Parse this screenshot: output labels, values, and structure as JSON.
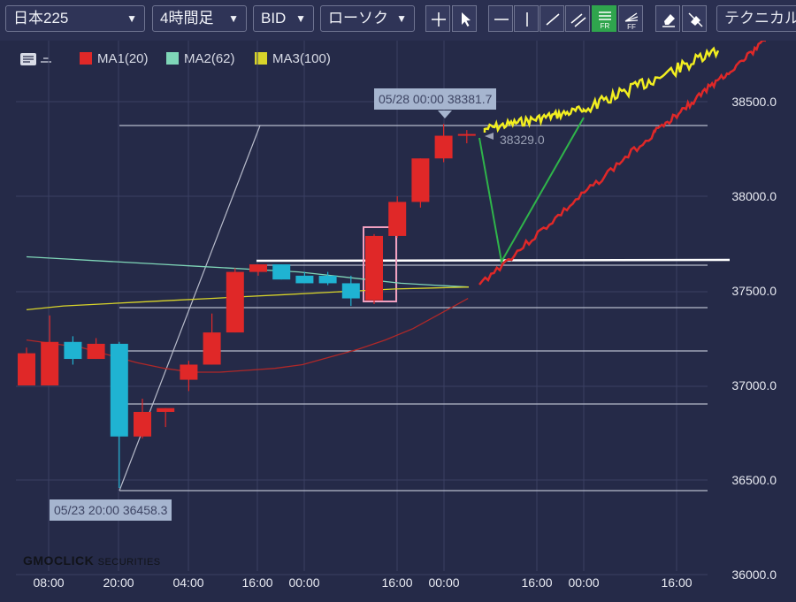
{
  "toolbar": {
    "symbol": "日本225",
    "timeframe": "4時間足",
    "price_type": "BID",
    "chart_type": "ローソク",
    "technical": "テクニカル",
    "tools": [
      "crosshair-icon",
      "pointer-icon",
      "hline-icon",
      "vline-icon",
      "trendline-icon",
      "channel-icon",
      "fibonacci-retracement-icon",
      "fibonacci-fan-icon",
      "eraser-icon",
      "clear-all-icon"
    ],
    "tool_labels": {
      "fr": "FR",
      "ff": "FF"
    }
  },
  "legend": {
    "items": [
      {
        "label": "MA1(20)",
        "color": "#e02828"
      },
      {
        "label": "MA2(62)",
        "color": "#7fd6b8"
      },
      {
        "label": "MA3(100)",
        "color": "#d8d42a"
      }
    ]
  },
  "tooltips": {
    "high": "05/28 00:00 38381.7",
    "low": "05/23 20:00 36458.3",
    "last_value": "38329.0"
  },
  "axes": {
    "y_ticks": [
      "38500.0",
      "38000.0",
      "37500.0",
      "37000.0",
      "36500.0",
      "36000.0"
    ],
    "x_ticks": [
      "08:00",
      "20:00",
      "04:00",
      "16:00",
      "00:00",
      "16:00",
      "00:00",
      "16:00",
      "00:00",
      "16:00"
    ]
  },
  "logo": {
    "brand": "GMOCLICK",
    "suffix": "SECURITIES"
  },
  "colors": {
    "up": "#e02828",
    "down": "#1fb3d2",
    "background": "#252a48",
    "grid": "#3a4062"
  },
  "chart_data": {
    "type": "candlestick",
    "ylim": [
      36000,
      38750
    ],
    "candles": [
      {
        "o": 37000,
        "h": 37200,
        "l": 37000,
        "c": 37170
      },
      {
        "o": 37000,
        "h": 37370,
        "l": 37000,
        "c": 37230
      },
      {
        "o": 37230,
        "h": 37260,
        "l": 37110,
        "c": 37140
      },
      {
        "o": 37140,
        "h": 37250,
        "l": 37140,
        "c": 37220
      },
      {
        "o": 37220,
        "h": 37230,
        "l": 36458,
        "c": 36730
      },
      {
        "o": 36730,
        "h": 36930,
        "l": 36720,
        "c": 36860
      },
      {
        "o": 36860,
        "h": 36880,
        "l": 36780,
        "c": 36880
      },
      {
        "o": 37030,
        "h": 37130,
        "l": 36970,
        "c": 37110
      },
      {
        "o": 37110,
        "h": 37380,
        "l": 37110,
        "c": 37280
      },
      {
        "o": 37280,
        "h": 37620,
        "l": 37280,
        "c": 37600
      },
      {
        "o": 37600,
        "h": 37640,
        "l": 37580,
        "c": 37640
      },
      {
        "o": 37640,
        "h": 37640,
        "l": 37560,
        "c": 37560
      },
      {
        "o": 37580,
        "h": 37600,
        "l": 37540,
        "c": 37540
      },
      {
        "o": 37580,
        "h": 37600,
        "l": 37530,
        "c": 37540
      },
      {
        "o": 37540,
        "h": 37580,
        "l": 37420,
        "c": 37460
      },
      {
        "o": 37450,
        "h": 37800,
        "l": 37430,
        "c": 37790
      },
      {
        "o": 37790,
        "h": 38000,
        "l": 37780,
        "c": 37970
      },
      {
        "o": 37970,
        "h": 38200,
        "l": 37940,
        "c": 38200
      },
      {
        "o": 38200,
        "h": 38381.7,
        "l": 38180,
        "c": 38320
      },
      {
        "o": 38329,
        "h": 38350,
        "l": 38280,
        "c": 38329
      }
    ],
    "series": [
      {
        "name": "MA1(20)",
        "values": [
          37240,
          37220,
          37200,
          37160,
          37120,
          37090,
          37070,
          37070,
          37080,
          37090,
          37110,
          37150,
          37190,
          37240,
          37300,
          37380,
          37460
        ]
      },
      {
        "name": "MA2(62)",
        "values": [
          37680,
          37670,
          37660,
          37650,
          37640,
          37630,
          37620,
          37610,
          37600,
          37580,
          37560,
          37540,
          37530,
          37520
        ]
      },
      {
        "name": "MA3(100)",
        "values": [
          37400,
          37420,
          37430,
          37440,
          37450,
          37460,
          37470,
          37480,
          37490,
          37500,
          37510,
          37515,
          37520
        ]
      }
    ]
  }
}
